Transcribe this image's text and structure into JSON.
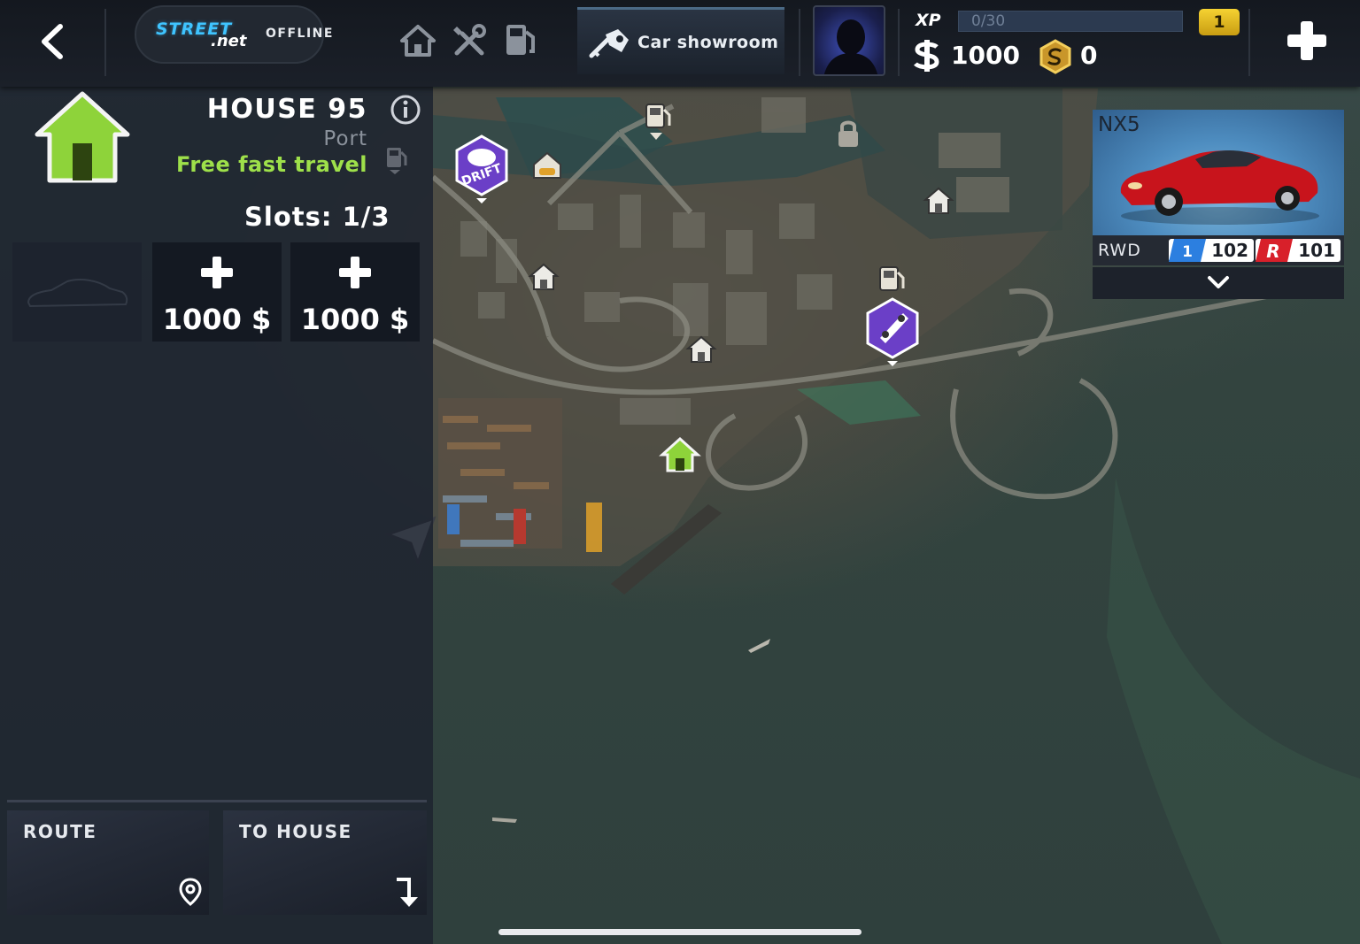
{
  "header": {
    "brand_street": "STREET",
    "brand_net": ".net",
    "status": "OFFLINE",
    "showroom_label": "Car showroom",
    "xp_label": "XP",
    "xp_progress_text": "0/30",
    "xp_progress_fraction": 0.0,
    "level": "1",
    "money": "1000",
    "gold": "0",
    "icons": [
      "back-arrow-icon",
      "home-icon",
      "tools-icon",
      "fuel-pump-icon",
      "car-key-icon",
      "avatar-silhouette",
      "dollar-icon",
      "gold-coin-icon",
      "plus-icon"
    ]
  },
  "house_panel": {
    "title": "HOUSE 95",
    "location": "Port",
    "fast_travel": "Free fast travel",
    "slots_label": "Slots: 1/3",
    "slots": [
      {
        "state": "occupied"
      },
      {
        "state": "buy",
        "price": "1000 $"
      },
      {
        "state": "buy",
        "price": "1000 $"
      }
    ],
    "route_label": "ROUTE",
    "to_house_label": "TO HOUSE"
  },
  "car_card": {
    "name": "NX5",
    "drive": "RWD",
    "class_c_rating": "102",
    "class_c_tier": "1",
    "class_r_rating": "101",
    "car_color": "#c8141c"
  },
  "map": {
    "markers": [
      "drift-event-icon",
      "garage-icon",
      "fuel-station-icon",
      "lock-icon",
      "house-icon",
      "selected-house-icon",
      "race-event-icon",
      "player-arrow-icon"
    ],
    "colors": {
      "selected_house": "#8ed33a",
      "event_purple": "#6b3fc7",
      "water": "#2f403d"
    }
  }
}
